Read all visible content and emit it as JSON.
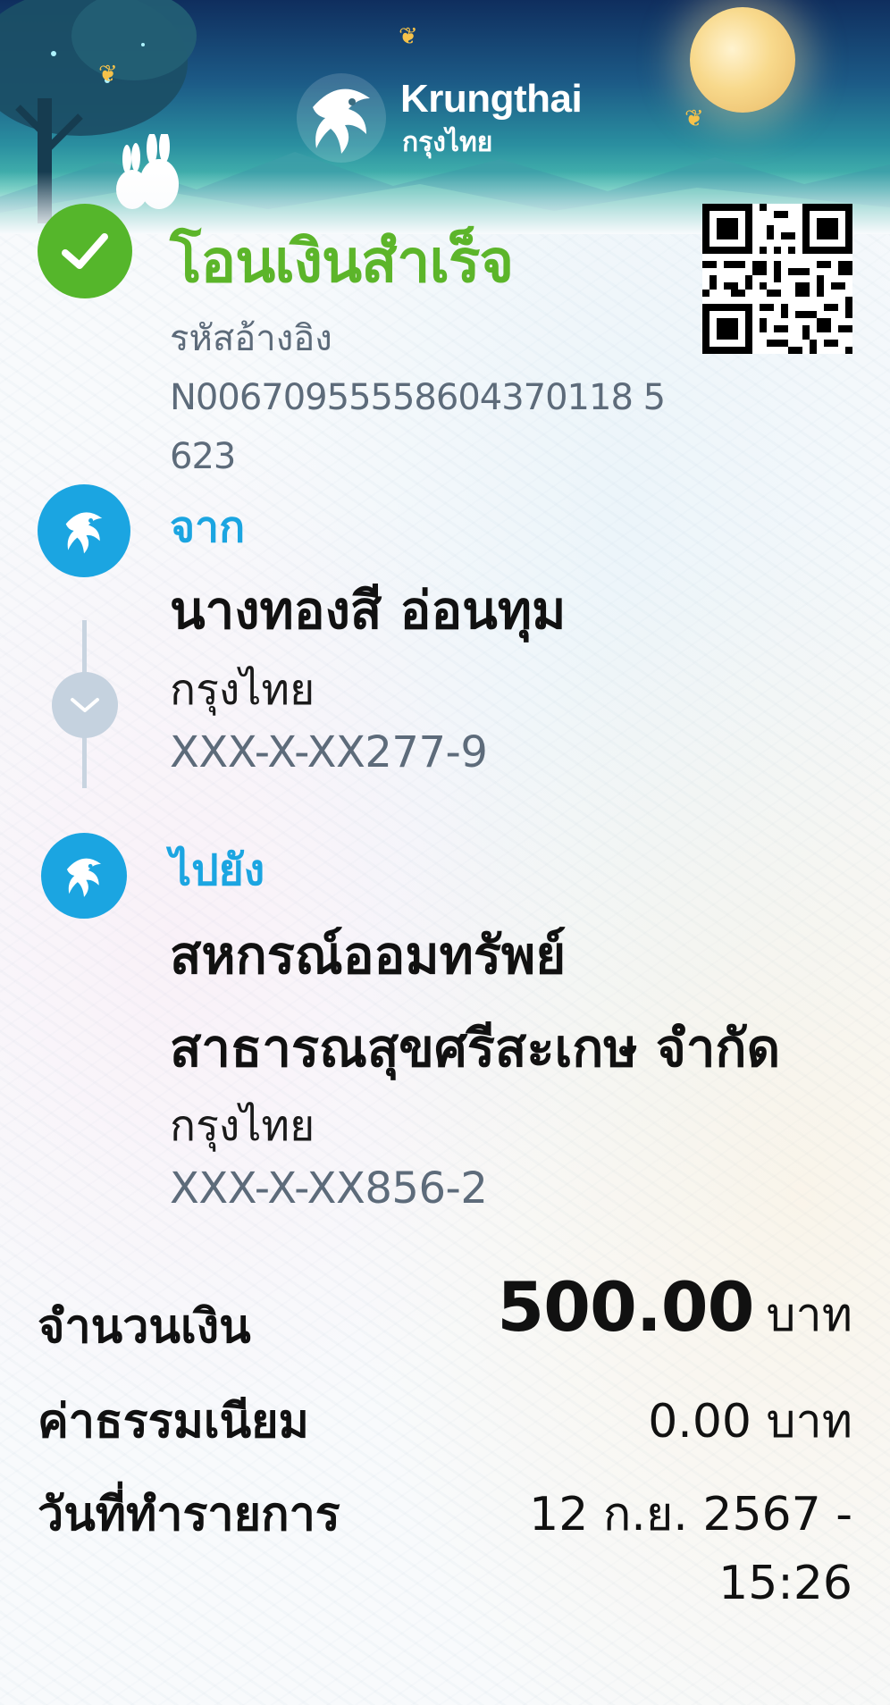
{
  "brand": {
    "name_en": "Krungthai",
    "name_th": "กรุงไทย"
  },
  "status": {
    "title": "โอนเงินสำเร็จ",
    "icon": "check-icon",
    "color": "#5cb52a"
  },
  "reference": {
    "label": "รหัสอ้างอิง",
    "value": "N00670955558604370118 5623"
  },
  "from": {
    "label": "จาก",
    "name": "นางทองสี อ่อนทุม",
    "bank": "กรุงไทย",
    "account": "XXX-X-XX277-9"
  },
  "to": {
    "label": "ไปยัง",
    "name_line1": "สหกรณ์ออมทรัพย์",
    "name_line2": "สาธารณสุขศรีสะเกษ จำกัด",
    "bank": "กรุงไทย",
    "account": "XXX-X-XX856-2"
  },
  "details": {
    "amount_label": "จำนวนเงิน",
    "amount_value": "500.00",
    "amount_unit": "บาท",
    "fee_label": "ค่าธรรมเนียม",
    "fee_value": "0.00 บาท",
    "date_label": "วันที่ทำรายการ",
    "date_value": "12 ก.ย. 2567 -",
    "time_value": "15:26"
  },
  "colors": {
    "accent_blue": "#1ba5e1",
    "success_green": "#5cb52a",
    "muted_text": "#5d6b7a"
  }
}
